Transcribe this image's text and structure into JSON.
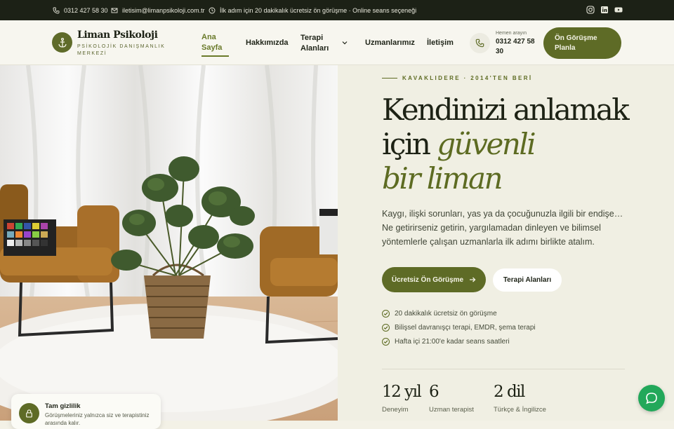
{
  "topbar": {
    "phone": "0312 427 58 30",
    "email": "iletisim@limanpsikoloji.com.tr",
    "notice": "İlk adım için 20 dakikalık ücretsiz ön görüşme · Online seans seçeneği",
    "social": [
      "instagram-icon",
      "linkedin-icon",
      "youtube-icon"
    ]
  },
  "brand": {
    "name": "Liman Psikoloji",
    "subtitle": "PSİKOLOJİK DANIŞMANLIK MERKEZİ"
  },
  "nav": {
    "items": [
      {
        "label": "Ana Sayfa",
        "active": true
      },
      {
        "label": "Hakkımızda",
        "active": false
      },
      {
        "label": "Terapi Alanları",
        "active": false,
        "dropdown": true
      },
      {
        "label": "Uzmanlarımız",
        "active": false
      },
      {
        "label": "İletişim",
        "active": false
      }
    ]
  },
  "header_call": {
    "label": "Hemen arayın",
    "number": "0312 427 58 30"
  },
  "header_cta": "Ön Görüşme Planla",
  "hero": {
    "eyebrow": "KAVAKLIDERE · 2014'TEN BERİ",
    "title_line1": "Kendinizi anlamak",
    "title_line2_plain": "için",
    "title_line2_em": "güvenli",
    "title_line3_em": "bir liman",
    "lead": "Kaygı, ilişki sorunları, yas ya da çocuğunuzla ilgili bir endişe… Ne getirirseniz getirin, yargılamadan dinleyen ve bilimsel yöntemlerle çalışan uzmanlarla ilk adımı birlikte atalım.",
    "primary_button": "Ücretsiz Ön Görüşme",
    "secondary_button": "Terapi Alanları",
    "checks": [
      "20 dakikalık ücretsiz ön görüşme",
      "Bilişsel davranışçı terapi, EMDR, şema terapi",
      "Hafta içi 21:00'e kadar seans saatleri"
    ],
    "stats": [
      {
        "value": "12 yıl",
        "label": "Deneyim"
      },
      {
        "value": "6",
        "label": "Uzman terapist"
      },
      {
        "value": "2 dil",
        "label": "Türkçe & İngilizce"
      }
    ]
  },
  "privacy": {
    "title": "Tam gizlilik",
    "text": "Görüşmeleriniz yalnızca siz ve terapistiniz arasında kalır."
  },
  "colors": {
    "accent": "#5e6b26",
    "dark": "#1c2116",
    "chat": "#22a85a"
  }
}
